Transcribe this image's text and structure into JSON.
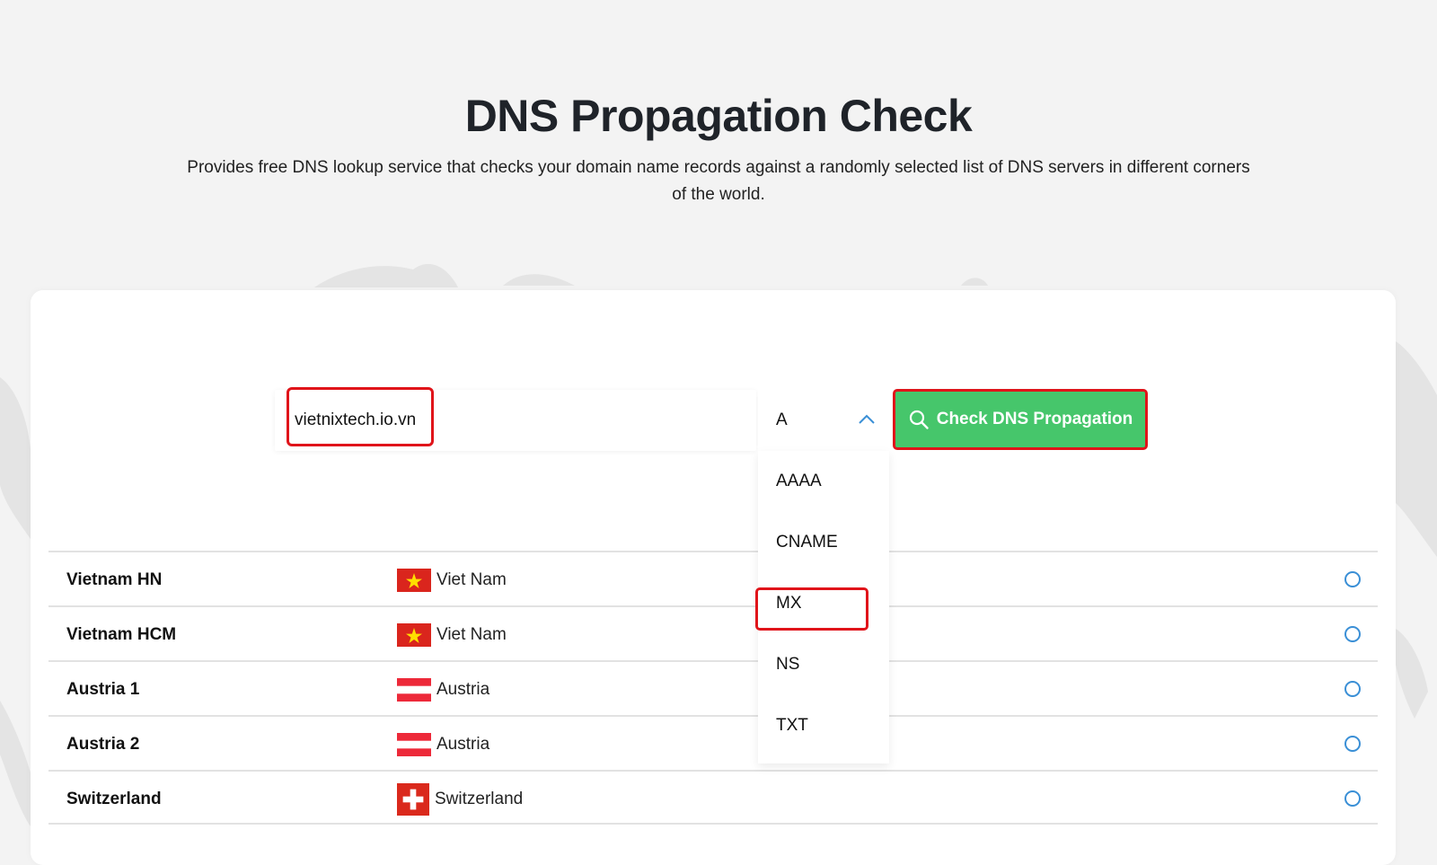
{
  "hero": {
    "title": "DNS Propagation Check",
    "subtitle": "Provides free DNS lookup service that checks your domain name records against a randomly selected list of DNS servers in different corners of the world."
  },
  "search": {
    "domain_value": "vietnixtech.io.vn",
    "record_type_selected": "A",
    "check_button_label": "Check DNS Propagation"
  },
  "dropdown": {
    "options": [
      "AAAA",
      "CNAME",
      "MX",
      "NS",
      "TXT"
    ],
    "highlighted": "MX"
  },
  "results": [
    {
      "server": "Vietnam HN",
      "country": "Viet Nam",
      "flag": "vietnam-flag-icon"
    },
    {
      "server": "Vietnam HCM",
      "country": "Viet Nam",
      "flag": "vietnam-flag-icon"
    },
    {
      "server": "Austria 1",
      "country": "Austria",
      "flag": "austria-flag-icon"
    },
    {
      "server": "Austria 2",
      "country": "Austria",
      "flag": "austria-flag-icon"
    },
    {
      "server": "Switzerland",
      "country": "Switzerland",
      "flag": "switzerland-flag-icon"
    }
  ],
  "colors": {
    "page_bg": "#f3f3f3",
    "button_green": "#46c66b",
    "highlight_red": "#e0141a",
    "status_blue": "#3a8fd6",
    "vietnam_red": "#da251d",
    "vietnam_star": "#ffde00",
    "austria_red": "#ed2939"
  }
}
